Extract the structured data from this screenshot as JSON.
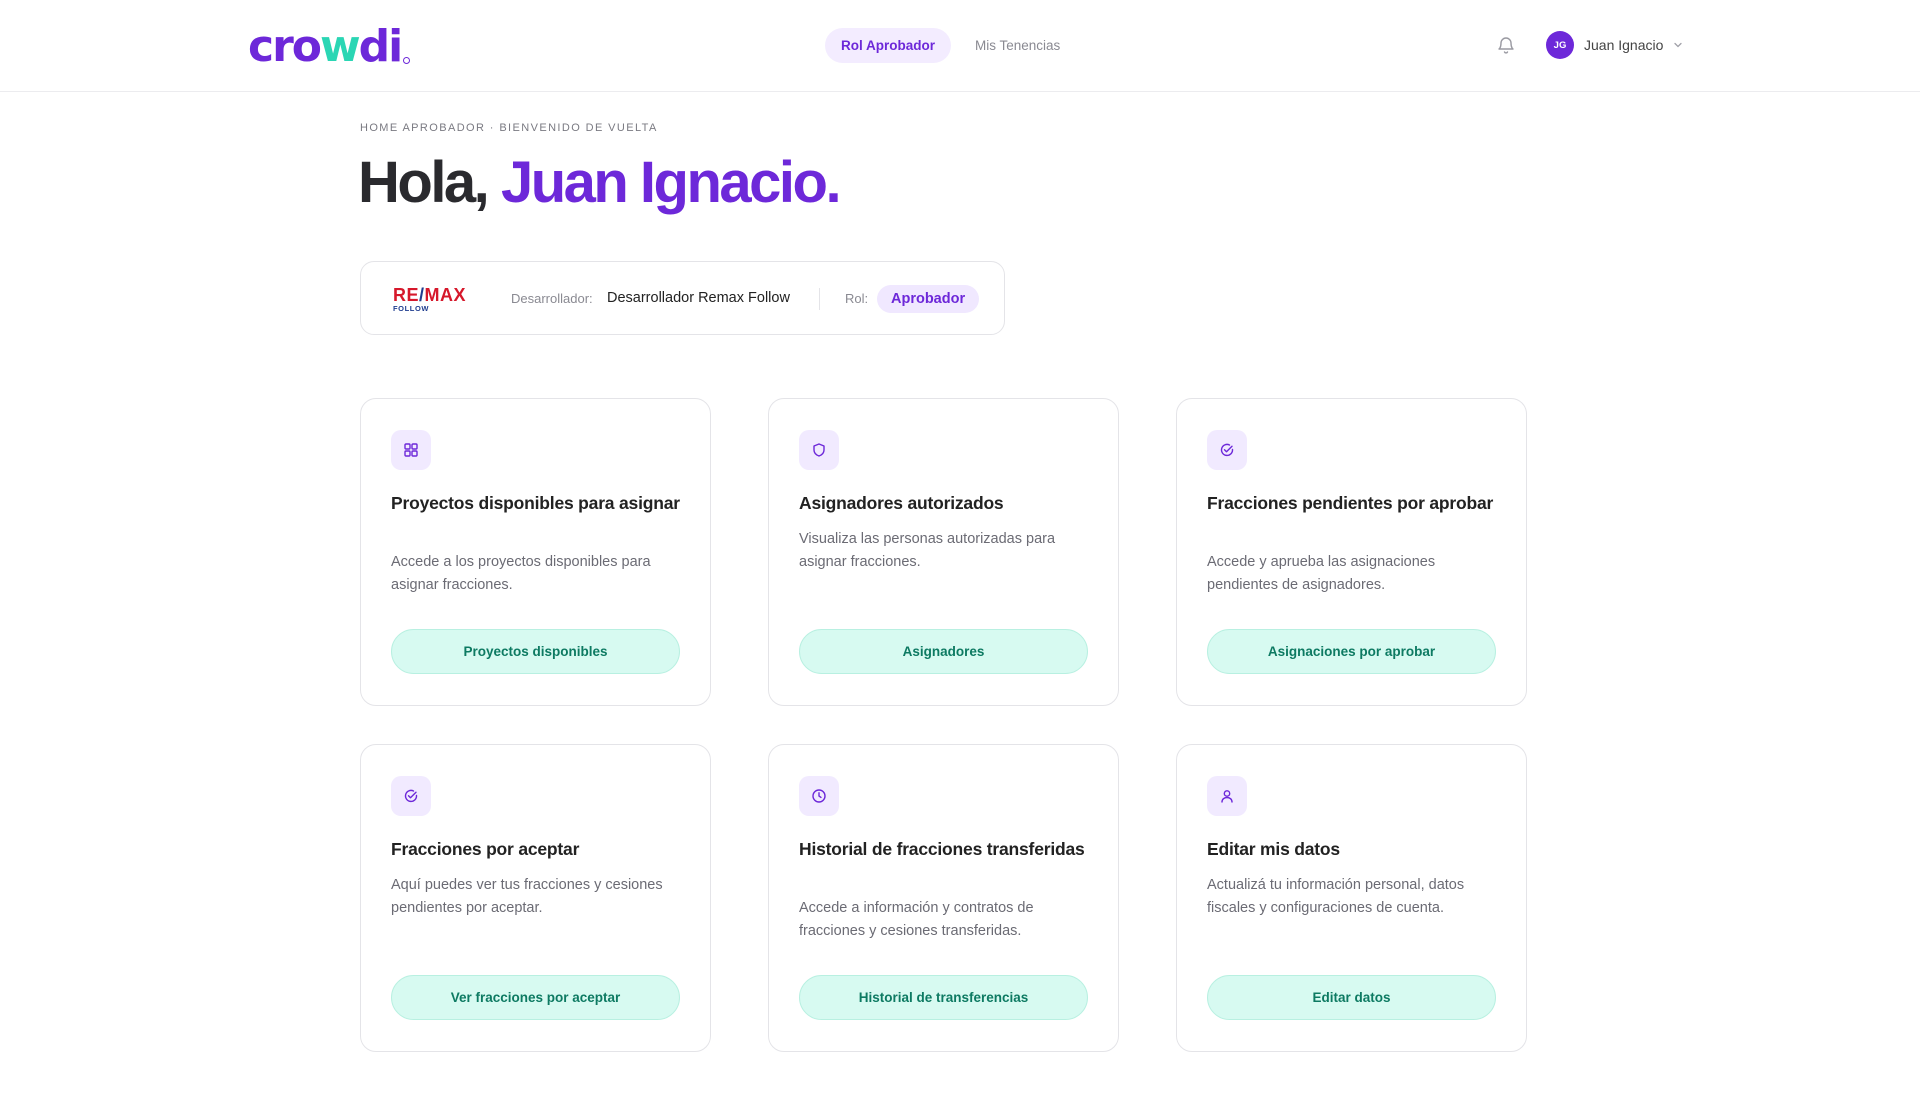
{
  "header": {
    "logo_text_a": "cro",
    "logo_text_w": "w",
    "logo_text_b": "di",
    "nav": [
      {
        "label": "Rol Aprobador",
        "active": true
      },
      {
        "label": "Mis Tenencias",
        "active": false
      }
    ],
    "user": {
      "initials": "JG",
      "name": "Juan Ignacio"
    }
  },
  "hero": {
    "eyebrow": "HOME APROBADOR · BIENVENIDO DE VUELTA",
    "greeting": "Hola,",
    "name": "Juan Ignacio."
  },
  "developer": {
    "brand_main_a": "RE",
    "brand_main_b": "/",
    "brand_main_c": "MAX",
    "brand_sub": "FOLLOW",
    "label": "Desarrollador:",
    "value": "Desarrollador Remax Follow",
    "rol_label": "Rol:",
    "rol_value": "Aprobador"
  },
  "cards": [
    {
      "icon": "grid-icon",
      "title": "Proyectos disponibles para asignar",
      "description": "Accede a los proyectos disponibles para asignar fracciones.",
      "button": "Proyectos disponibles"
    },
    {
      "icon": "shield-icon",
      "title": "Asignadores autorizados",
      "description": "Visualiza las personas autorizadas para asignar fracciones.",
      "button": "Asignadores"
    },
    {
      "icon": "check-circle-icon",
      "title": "Fracciones pendientes por aprobar",
      "description": "Accede y aprueba las asignaciones pendientes de asignadores.",
      "button": "Asignaciones por aprobar"
    },
    {
      "icon": "check-circle-icon",
      "title": "Fracciones por aceptar",
      "description": "Aquí puedes ver tus fracciones y cesiones pendientes por aceptar.",
      "button": "Ver fracciones por aceptar"
    },
    {
      "icon": "clock-icon",
      "title": "Historial de fracciones transferidas",
      "description": "Accede a información y contratos de fracciones y cesiones transferidas.",
      "button": "Historial de transferencias"
    },
    {
      "icon": "user-icon",
      "title": "Editar mis datos",
      "description": "Actualizá tu información personal, datos fiscales y configuraciones de cuenta.",
      "button": "Editar datos"
    }
  ],
  "colors": {
    "brand_purple": "#6d28d9",
    "brand_teal": "#2ad6b4",
    "button_bg": "#d7faf1",
    "button_text": "#0d7a62",
    "icon_bg": "#f1eaff"
  }
}
